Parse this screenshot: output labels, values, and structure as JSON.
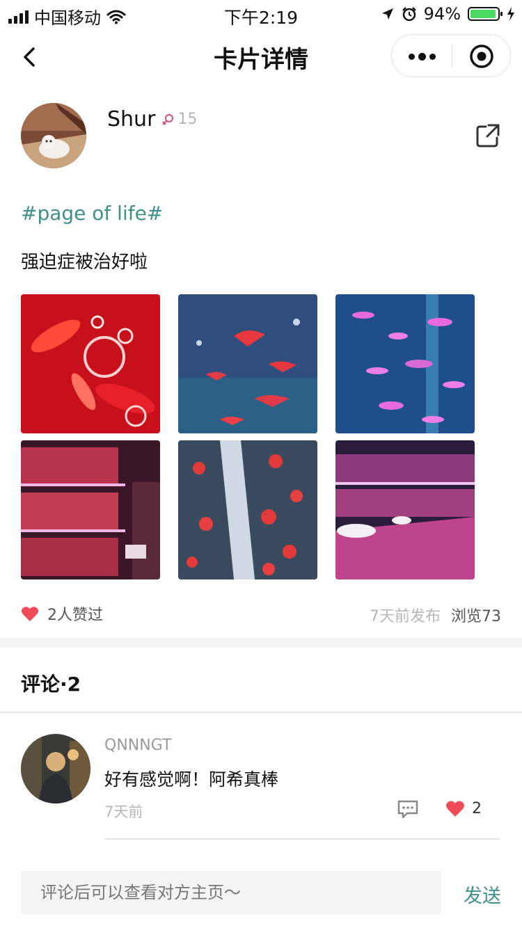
{
  "status_bar": {
    "carrier": "中国移动",
    "time": "下午2:19",
    "battery": "94%",
    "battery_level": 0.94
  },
  "nav": {
    "title": "卡片详情",
    "icons": [
      "back-chevron-icon",
      "more-dots-icon",
      "close-target-icon"
    ]
  },
  "post": {
    "author": "Shur",
    "gender_icon": "female-icon",
    "level": "15",
    "hashtag": "#page of life#",
    "text": "强迫症被治好啦",
    "photos": [
      "red-fish-bubbles",
      "red-guppies-blue-tank",
      "pink-tetras-blue-tank",
      "aquarium-shop-shelves",
      "red-fish-bubble-stream",
      "aquarium-shop-tubs"
    ],
    "likes": "2人赞过",
    "posted": "7天前发布",
    "views": "浏览73",
    "accent_color": "#3f8f8a",
    "like_color": "#f04a57"
  },
  "comments": {
    "header": "评论·2",
    "items": [
      {
        "name": "QNNNGT",
        "text": "好有感觉啊！阿希真棒",
        "time": "7天前",
        "likes": "2"
      }
    ]
  },
  "composer": {
    "placeholder": "评论后可以查看对方主页～",
    "send": "发送"
  }
}
